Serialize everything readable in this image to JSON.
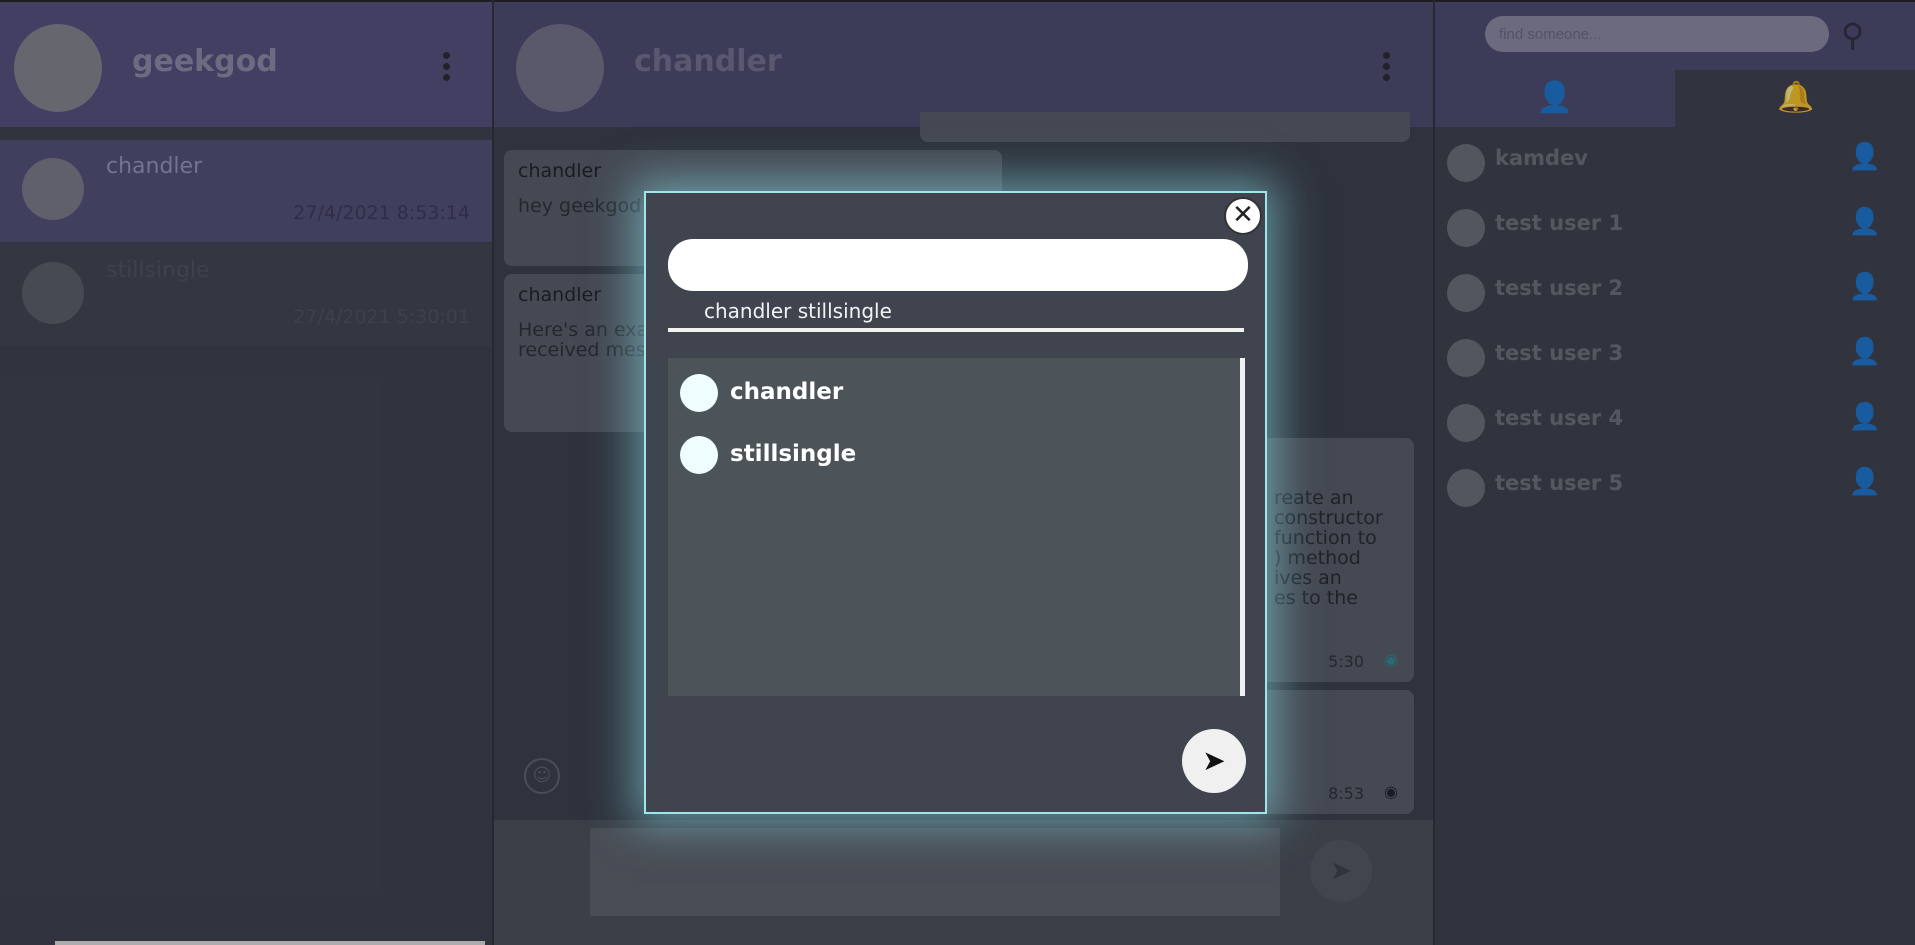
{
  "left": {
    "username": "geekgod",
    "conversations": [
      {
        "name": "chandler",
        "time": "27/4/2021 8:53:14"
      },
      {
        "name": "stillsingle",
        "time": "27/4/2021 5:30:01"
      }
    ]
  },
  "chat": {
    "contact": "chandler",
    "messages": [
      {
        "sender": "chandler",
        "text": "hey geekgod"
      },
      {
        "sender": "chandler",
        "text": "Here's an example of a simple observer that received messages"
      }
    ],
    "right_messages": [
      {
        "text": "reate an\nconstructor\nfunction to\n) method\nives an\nes to the",
        "time": "5:30"
      },
      {
        "text": "",
        "time": "8:53"
      }
    ]
  },
  "right": {
    "search_placeholder": "find someone...",
    "requests": [
      {
        "name": "kamdev"
      },
      {
        "name": "test user 1"
      },
      {
        "name": "test user 2"
      },
      {
        "name": "test user 3"
      },
      {
        "name": "test user 4"
      },
      {
        "name": "test user 5"
      }
    ]
  },
  "modal": {
    "selected_text": "chandler stillsingle",
    "users": [
      {
        "name": "chandler"
      },
      {
        "name": "stillsingle"
      }
    ]
  },
  "icons": {
    "menu": "kebab-menu-icon",
    "search": "search-icon",
    "add_user": "add-user-icon",
    "bell": "bell-icon",
    "send": "send-icon",
    "close": "close-icon",
    "eye": "eye-icon"
  },
  "colors": {
    "header": "#54507e",
    "modal_glow": "#9fe5ea",
    "modal_bg": "#3f444f"
  }
}
